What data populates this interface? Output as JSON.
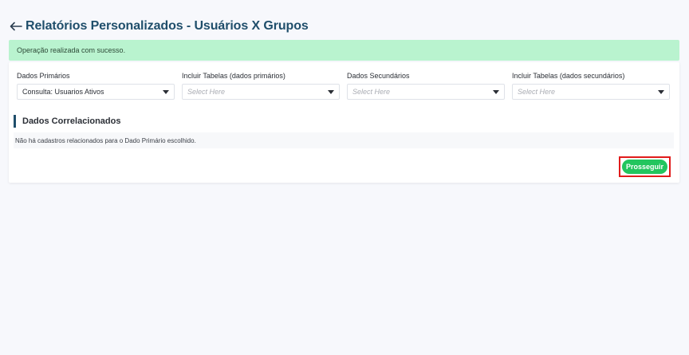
{
  "header": {
    "title": "Relatórios Personalizados - Usuários X Grupos"
  },
  "alert": {
    "message": "Operação realizada com sucesso.",
    "color": "#b9f3cf"
  },
  "filters": [
    {
      "label": "Dados Primários",
      "value": "Consulta: Usuarios Ativos",
      "placeholder": ""
    },
    {
      "label": "Incluir Tabelas (dados primários)",
      "value": "",
      "placeholder": "Select Here"
    },
    {
      "label": "Dados Secundários",
      "value": "",
      "placeholder": "Select Here"
    },
    {
      "label": "Incluir Tabelas (dados secundários)",
      "value": "",
      "placeholder": "Select Here"
    }
  ],
  "section": {
    "title": "Dados Correlacionados",
    "empty_message": "Não há cadastros relacionados para o Dado Primário escolhido."
  },
  "actions": {
    "proceed_label": "Prosseguir",
    "proceed_color": "#22c55e"
  }
}
